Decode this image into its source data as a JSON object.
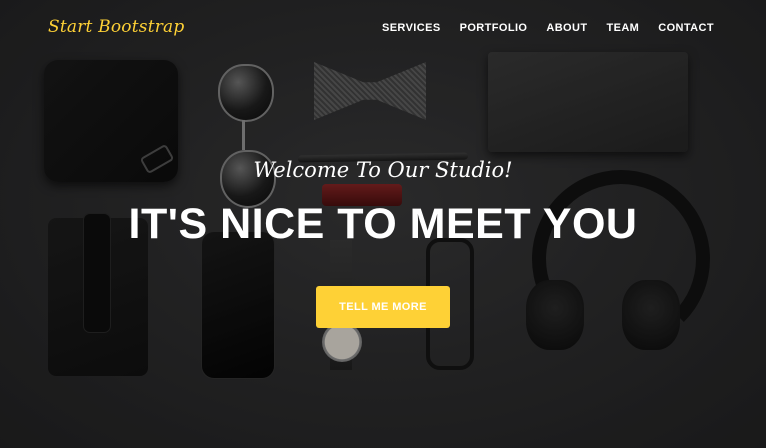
{
  "navbar": {
    "brand": "Start Bootstrap",
    "links": [
      "SERVICES",
      "PORTFOLIO",
      "ABOUT",
      "TEAM",
      "CONTACT"
    ]
  },
  "hero": {
    "lead": "Welcome To Our Studio!",
    "heading": "IT'S NICE TO MEET YOU",
    "cta_label": "TELL ME MORE"
  },
  "colors": {
    "accent": "#fed136",
    "text": "#ffffff"
  }
}
